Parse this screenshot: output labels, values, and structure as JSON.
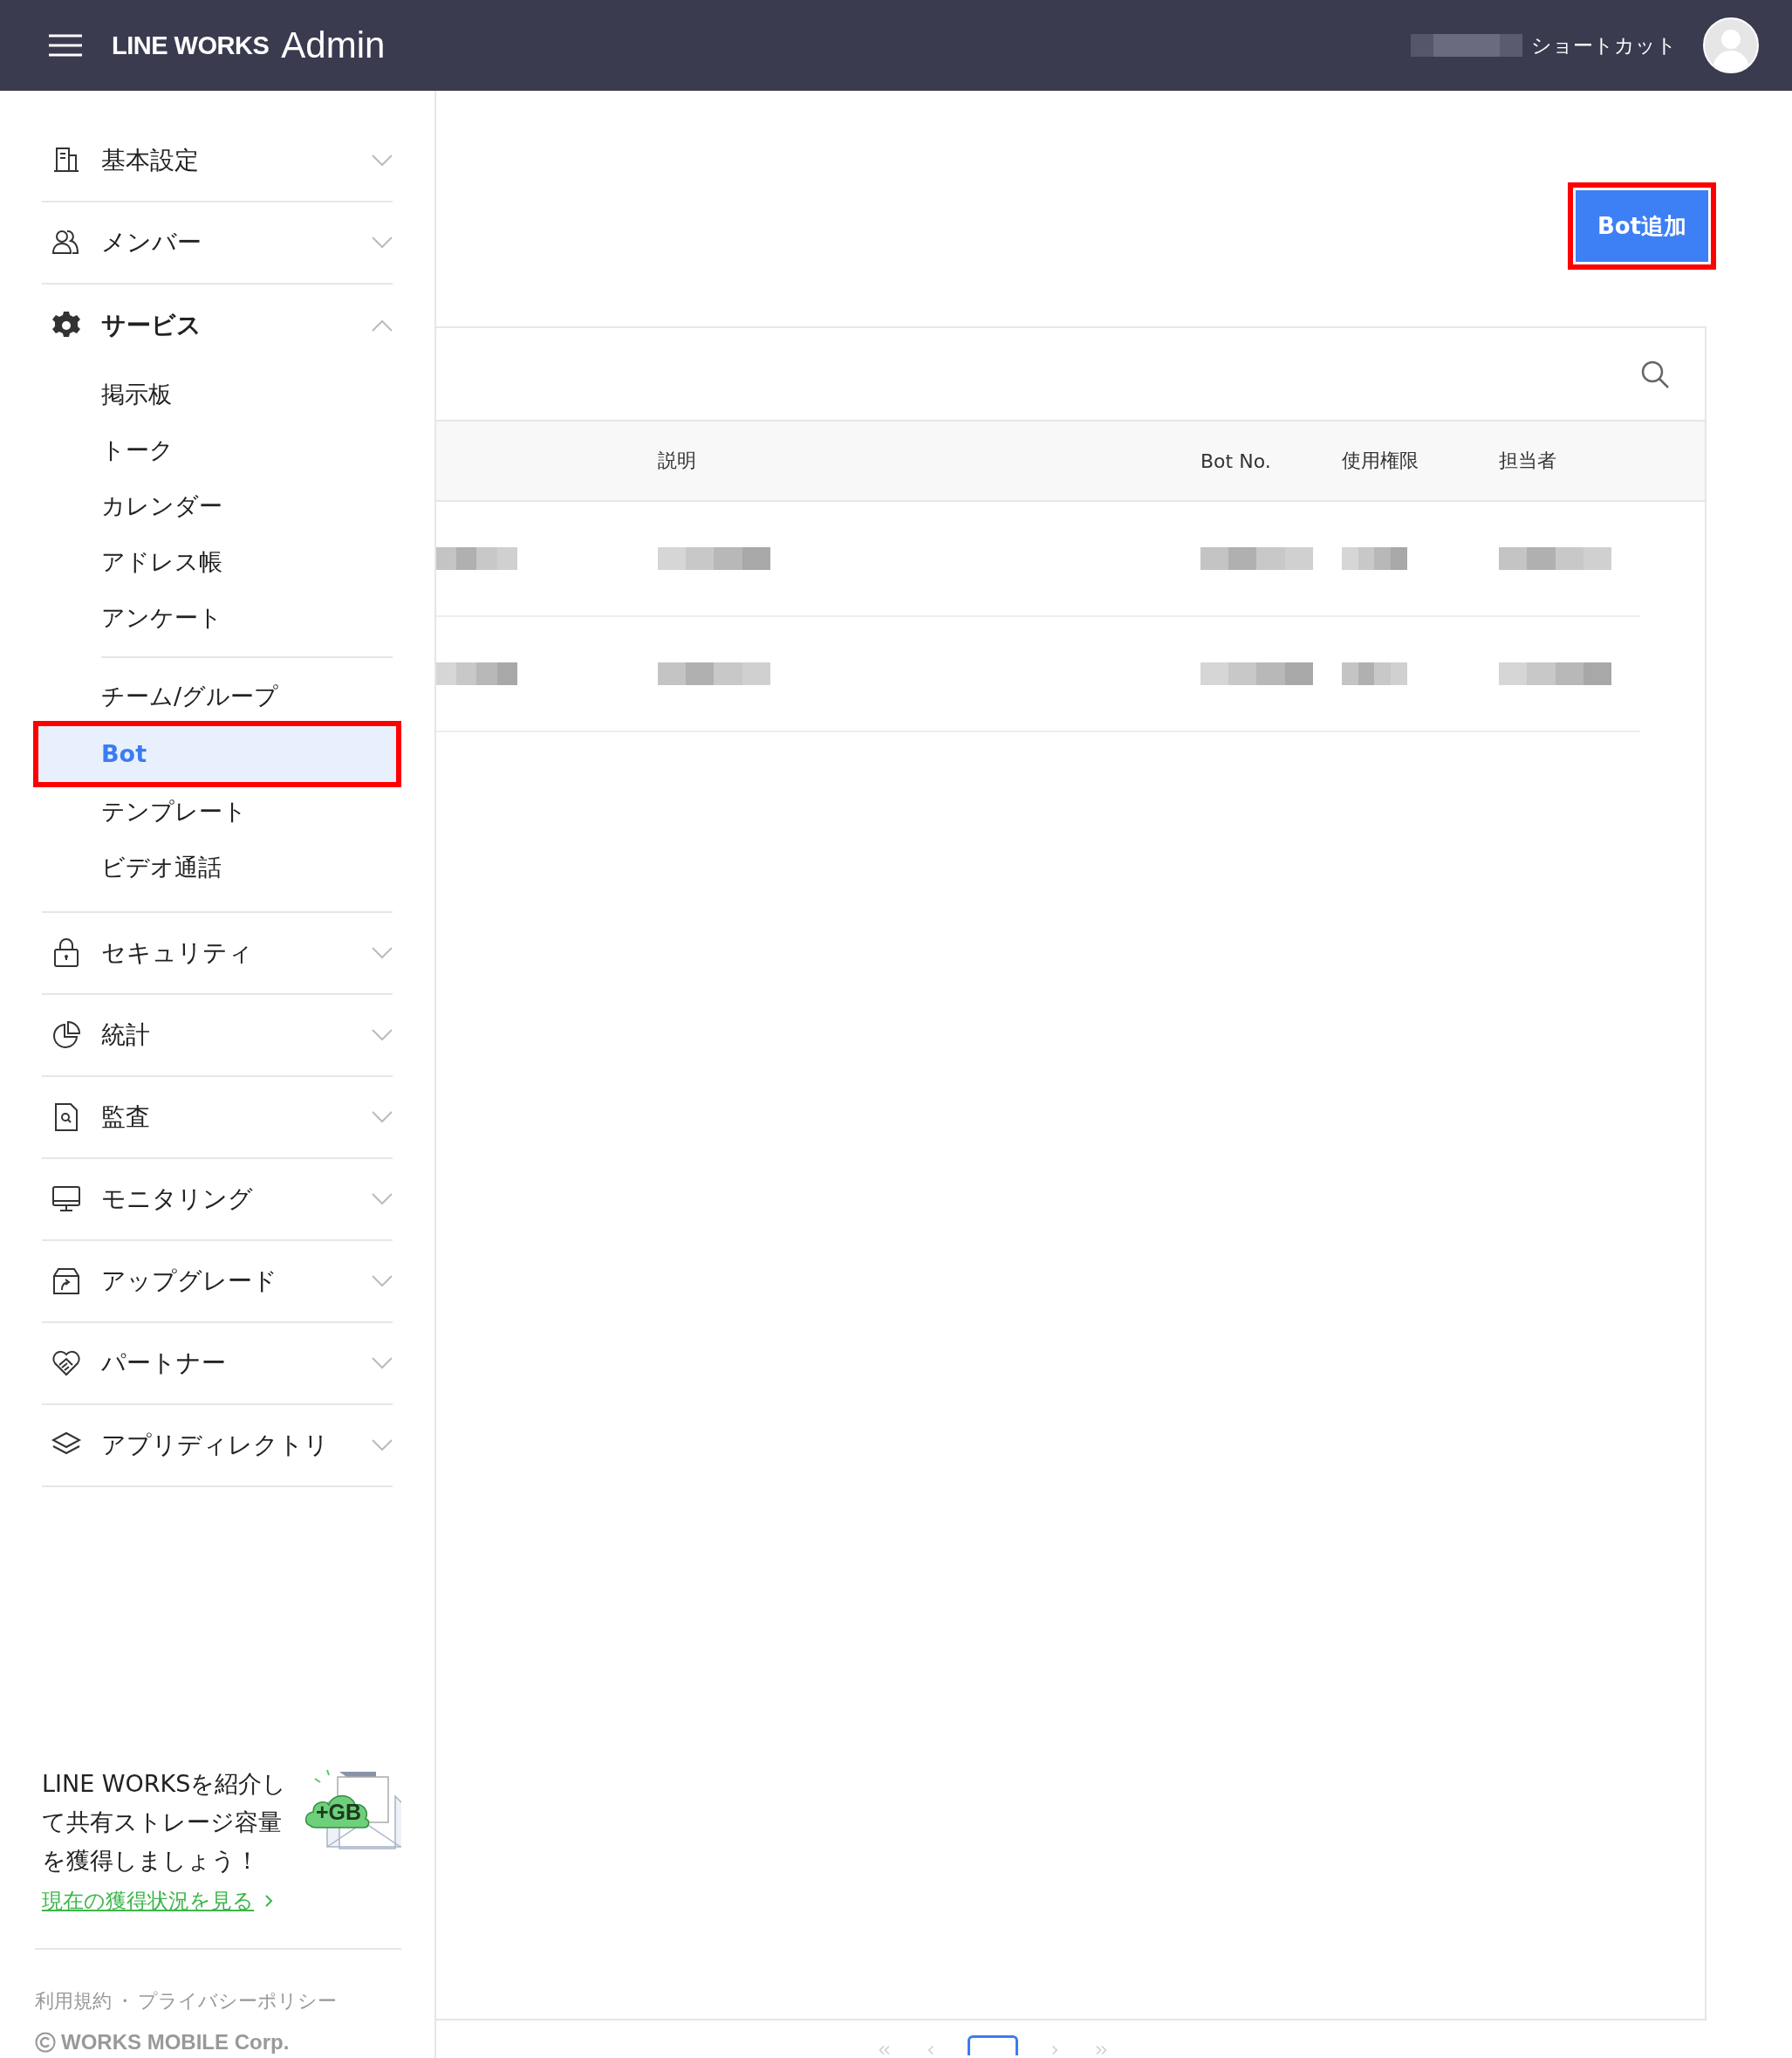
{
  "header": {
    "brand": "LINE WORKS",
    "product": "Admin",
    "shortcut": "ショートカット"
  },
  "sidebar": {
    "sections": [
      {
        "label": "基本設定",
        "expanded": false
      },
      {
        "label": "メンバー",
        "expanded": false
      },
      {
        "label": "サービス",
        "expanded": true,
        "children": [
          {
            "label": "掲示板",
            "selected": false,
            "highlighted": false,
            "divider_before": false
          },
          {
            "label": "トーク",
            "selected": false,
            "highlighted": false,
            "divider_before": false
          },
          {
            "label": "カレンダー",
            "selected": false,
            "highlighted": false,
            "divider_before": false
          },
          {
            "label": "アドレス帳",
            "selected": false,
            "highlighted": false,
            "divider_before": false
          },
          {
            "label": "アンケート",
            "selected": false,
            "highlighted": false,
            "divider_before": false
          },
          {
            "label": "チーム/グループ",
            "selected": false,
            "highlighted": false,
            "divider_before": true
          },
          {
            "label": "Bot",
            "selected": true,
            "highlighted": true,
            "divider_before": false
          },
          {
            "label": "テンプレート",
            "selected": false,
            "highlighted": false,
            "divider_before": false
          },
          {
            "label": "ビデオ通話",
            "selected": false,
            "highlighted": false,
            "divider_before": false
          }
        ]
      },
      {
        "label": "セキュリティ",
        "expanded": false
      },
      {
        "label": "統計",
        "expanded": false
      },
      {
        "label": "監査",
        "expanded": false
      },
      {
        "label": "モニタリング",
        "expanded": false
      },
      {
        "label": "アップグレード",
        "expanded": false
      },
      {
        "label": "パートナー",
        "expanded": false
      },
      {
        "label": "アプリディレクトリ",
        "expanded": false
      }
    ],
    "promo": {
      "text": "LINE WORKSを紹介して共有ストレージ容量を獲得しましょう！",
      "badge": "+GB",
      "link": "現在の獲得状況を見る"
    },
    "footer": {
      "links": [
        "利用規約",
        "プライバシーポリシー"
      ],
      "separator": "・",
      "copyright": "WORKS MOBILE Corp."
    }
  },
  "main": {
    "add_button": {
      "label": "Bot追加",
      "highlighted": true
    },
    "table": {
      "columns": [
        "",
        "説明",
        "Bot No.",
        "使用権限",
        "担当者"
      ],
      "rows": [
        {
          "kind": "redacted"
        },
        {
          "kind": "redacted"
        }
      ]
    },
    "pagination": {
      "pages": [
        {
          "selected": true
        }
      ]
    }
  }
}
